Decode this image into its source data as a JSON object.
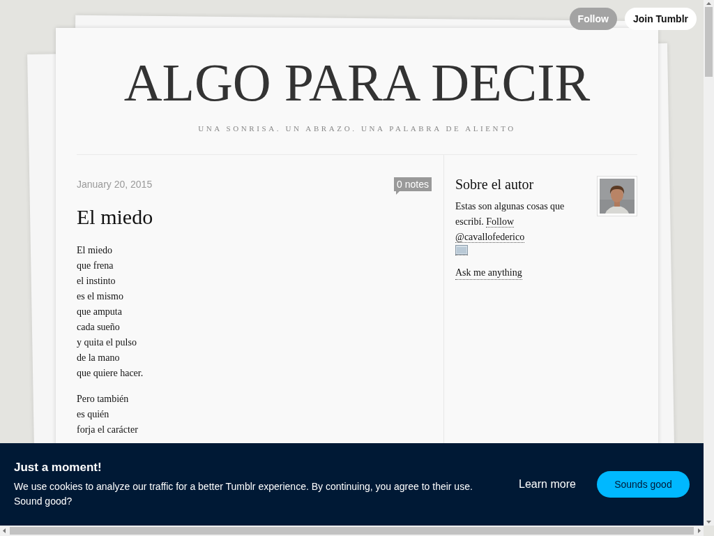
{
  "top_buttons": [
    {
      "label": "Follow",
      "kind": "follow"
    },
    {
      "label": "Join Tumblr",
      "kind": "join"
    }
  ],
  "blog": {
    "title": "ALGO PARA DECIR",
    "tagline": "UNA SONRISA. UN ABRAZO. UNA PALABRA DE ALIENTO"
  },
  "post": {
    "date": "January 20, 2015",
    "notes": "0 notes",
    "title": "El miedo",
    "stanzas": [
      [
        "El miedo",
        "que frena",
        "el instinto",
        "es el mismo",
        "que amputa",
        "cada sueño",
        "y quita el pulso",
        "de la mano",
        "que quiere hacer."
      ],
      [
        "Pero también",
        "es quién",
        "forja el carácter"
      ]
    ]
  },
  "sidebar": {
    "heading": "Sobre el autor",
    "text": "Estas son algunas cosas que escribí.",
    "links": [
      "Follow",
      "@cavallofederico"
    ],
    "ask_link": "Ask me anything"
  },
  "cookie_banner": {
    "title": "Just a moment!",
    "text": "We use cookies to analyze our traffic for a better Tumblr experience. By continuing, you agree to their use. Sound good?",
    "learn_more": "Learn more",
    "accept": "Sounds good"
  }
}
